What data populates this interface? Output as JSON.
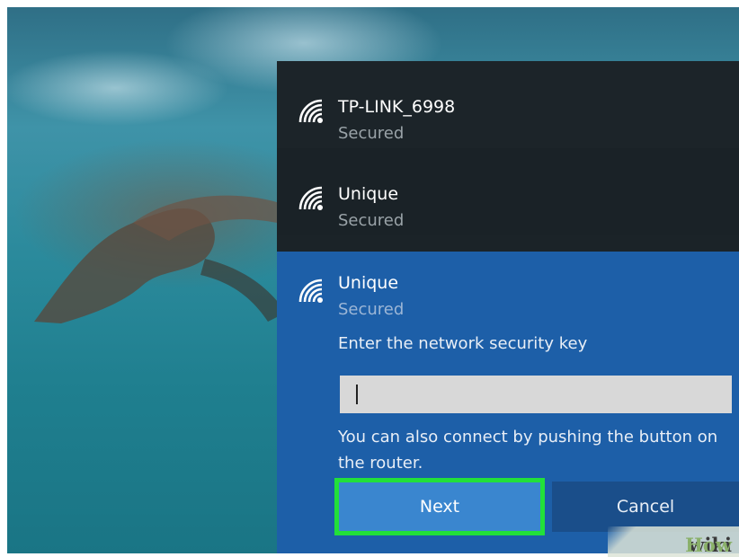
{
  "networks": [
    {
      "ssid": "TP-LINK_6998",
      "status": "Secured",
      "icon": "wifi-icon"
    },
    {
      "ssid": "Unique",
      "status": "Secured",
      "icon": "wifi-icon"
    }
  ],
  "selected_network": {
    "ssid": "Unique",
    "status": "Secured",
    "icon": "wifi-icon",
    "key_prompt": "Enter the network security key",
    "key_value": "",
    "hint": "You can also connect by pushing the button on the router.",
    "next_label": "Next",
    "cancel_label": "Cancel"
  },
  "watermark": {
    "part1": "wiki",
    "part2": "How"
  },
  "colors": {
    "panel_dark": "#1c2429",
    "selected_blue": "#1d5fa8",
    "next_button": "#3a86cf",
    "highlight_border": "#22e03a"
  }
}
